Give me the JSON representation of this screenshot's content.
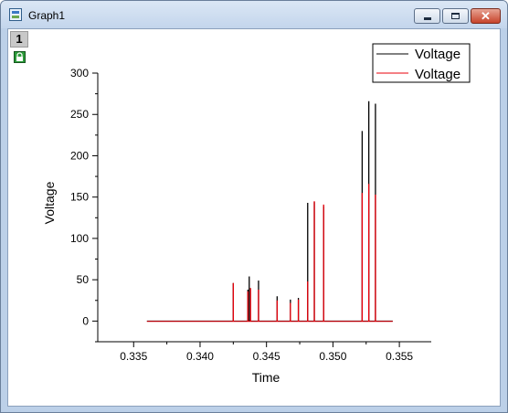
{
  "window": {
    "title": "Graph1",
    "close_glyph": "✕"
  },
  "layer": {
    "number": "1"
  },
  "icons": {
    "app": "graph-window-icon",
    "lock": "lock-icon",
    "minimize": "minimize-icon",
    "maximize": "maximize-icon",
    "close": "close-icon"
  },
  "colors": {
    "series_black": "#000000",
    "series_red": "#e8000b",
    "title_bar": "#c9d9ee"
  },
  "chart_data": {
    "type": "line",
    "title": "",
    "xlabel": "Time",
    "ylabel": "Voltage",
    "xlim": [
      0.3323,
      0.3574
    ],
    "ylim": [
      -25,
      300
    ],
    "xticks": [
      0.335,
      0.34,
      0.345,
      0.35,
      0.355
    ],
    "xtick_labels": [
      "0.335",
      "0.340",
      "0.345",
      "0.350",
      "0.355"
    ],
    "yticks": [
      0,
      50,
      100,
      150,
      200,
      250,
      300
    ],
    "ytick_labels": [
      "0",
      "50",
      "100",
      "150",
      "200",
      "250",
      "300"
    ],
    "grid": false,
    "legend": {
      "position": "top-right",
      "entries": [
        "Voltage",
        "Voltage"
      ]
    },
    "series": [
      {
        "name": "Voltage",
        "color": "#000000",
        "peaks": [
          [
            0.3425,
            46
          ],
          [
            0.3436,
            38
          ],
          [
            0.3437,
            54
          ],
          [
            0.3444,
            49
          ],
          [
            0.3458,
            30
          ],
          [
            0.3468,
            26
          ],
          [
            0.3474,
            28
          ],
          [
            0.3481,
            143
          ],
          [
            0.3486,
            144
          ],
          [
            0.3493,
            139
          ],
          [
            0.3522,
            230
          ],
          [
            0.3527,
            266
          ],
          [
            0.3532,
            263
          ]
        ]
      },
      {
        "name": "Voltage",
        "color": "#e8000b",
        "peaks": [
          [
            0.3425,
            46
          ],
          [
            0.3436,
            36
          ],
          [
            0.3438,
            40
          ],
          [
            0.3444,
            38
          ],
          [
            0.3458,
            25
          ],
          [
            0.3468,
            22
          ],
          [
            0.3474,
            26
          ],
          [
            0.3481,
            48
          ],
          [
            0.3486,
            145
          ],
          [
            0.3493,
            141
          ],
          [
            0.3522,
            155
          ],
          [
            0.3527,
            166
          ],
          [
            0.3532,
            153
          ]
        ]
      }
    ],
    "x_range": [
      0.336,
      0.3545
    ]
  }
}
